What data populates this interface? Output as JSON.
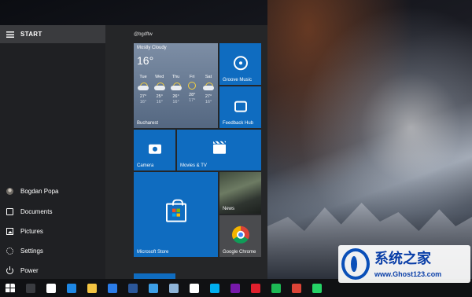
{
  "start": {
    "title": "START",
    "username": "@bgdftw",
    "left_items": [
      {
        "label": "Bogdan Popa",
        "icon": "avatar"
      },
      {
        "label": "Documents",
        "icon": "document-icon"
      },
      {
        "label": "Pictures",
        "icon": "pictures-icon"
      },
      {
        "label": "Settings",
        "icon": "gear-icon"
      },
      {
        "label": "Power",
        "icon": "power-icon"
      }
    ]
  },
  "weather": {
    "condition": "Mostly Cloudy",
    "temp": "16°",
    "city": "Bucharest",
    "days": [
      {
        "day": "Tue",
        "icon": "cloud-icon",
        "hi": "27°",
        "lo": "16°"
      },
      {
        "day": "Wed",
        "icon": "cloud-icon",
        "hi": "25°",
        "lo": "16°"
      },
      {
        "day": "Thu",
        "icon": "cloud-icon",
        "hi": "26°",
        "lo": "16°"
      },
      {
        "day": "Fri",
        "icon": "sun-icon",
        "hi": "28°",
        "lo": "17°"
      },
      {
        "day": "Sat",
        "icon": "cloud-icon",
        "hi": "27°",
        "lo": "16°"
      }
    ]
  },
  "tiles": {
    "groove": "Groove Music",
    "feedback": "Feedback Hub",
    "camera": "Camera",
    "movies": "Movies & TV",
    "news": "News",
    "store": "Microsoft Store",
    "chrome": "Google Chrome"
  },
  "taskbar": {
    "apps": [
      {
        "name": "task-view-icon",
        "color": "#3a3c40"
      },
      {
        "name": "mail-icon",
        "color": "#ffffff"
      },
      {
        "name": "edge-icon",
        "color": "#1e88e5"
      },
      {
        "name": "file-explorer-icon",
        "color": "#f4c542"
      },
      {
        "name": "store-icon",
        "color": "#2b7de9"
      },
      {
        "name": "word-icon",
        "color": "#2b579a"
      },
      {
        "name": "app-icon",
        "color": "#3da0e8"
      },
      {
        "name": "computer-icon",
        "color": "#8fb4d8"
      },
      {
        "name": "s-app-icon",
        "color": "#ffffff"
      },
      {
        "name": "skype-icon",
        "color": "#00aff0"
      },
      {
        "name": "onenote-icon",
        "color": "#7719aa"
      },
      {
        "name": "opera-icon",
        "color": "#e0202d"
      },
      {
        "name": "spotify-icon",
        "color": "#1db954"
      },
      {
        "name": "chrome-icon",
        "color": "#db4437"
      },
      {
        "name": "whatsapp-icon",
        "color": "#25d366"
      }
    ]
  },
  "watermark": {
    "title": "系统之家",
    "url": "www.Ghost123.com"
  }
}
